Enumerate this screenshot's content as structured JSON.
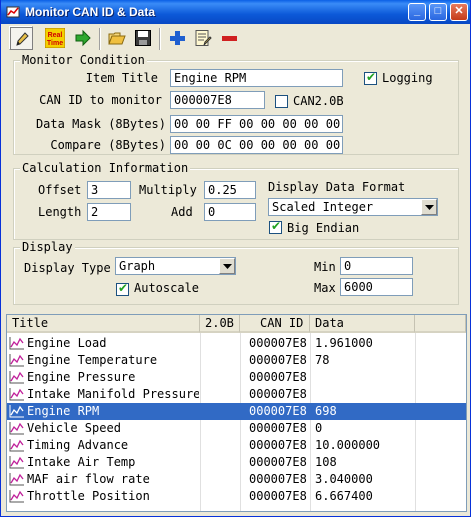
{
  "window": {
    "title": "Monitor CAN ID & Data"
  },
  "title_buttons": {
    "minimize": "_",
    "maximize": "□",
    "close": "✕"
  },
  "toolbar": {
    "items": [
      {
        "name": "edit-pencil-icon",
        "pressed": true
      },
      {
        "name": "realtime-icon",
        "text_top": "Real",
        "text_bottom": "Time"
      },
      {
        "name": "go-arrow-icon"
      },
      {
        "name": "open-folder-icon"
      },
      {
        "name": "save-disk-icon"
      },
      {
        "name": "add-plus-icon"
      },
      {
        "name": "edit-list-icon"
      },
      {
        "name": "remove-minus-icon"
      }
    ]
  },
  "monitor_condition": {
    "legend": "Monitor Condition",
    "item_title_label": "Item Title",
    "item_title_value": "Engine RPM",
    "logging_label": "Logging",
    "logging_checked": true,
    "can_id_label": "CAN ID to monitor",
    "can_id_value": "000007E8",
    "can20b_label": "CAN2.0B",
    "can20b_checked": false,
    "data_mask_label": "Data Mask (8Bytes)",
    "data_mask_value": "00 00 FF 00 00 00 00 00",
    "compare_label": "Compare (8Bytes)",
    "compare_value": "00 00 0C 00 00 00 00 00"
  },
  "calculation": {
    "legend": "Calculation Information",
    "offset_label": "Offset",
    "offset_value": "3",
    "multiply_label": "Multiply",
    "multiply_value": "0.25",
    "length_label": "Length",
    "length_value": "2",
    "add_label": "Add",
    "add_value": "0",
    "format_label": "Display Data Format",
    "format_value": "Scaled Integer",
    "big_endian_label": "Big Endian",
    "big_endian_checked": true
  },
  "display": {
    "legend": "Display",
    "type_label": "Display Type",
    "type_value": "Graph",
    "autoscale_label": "Autoscale",
    "autoscale_checked": true,
    "min_label": "Min",
    "min_value": "0",
    "max_label": "Max",
    "max_value": "6000"
  },
  "list": {
    "columns": [
      "Title",
      "2.0B",
      "CAN ID",
      "Data"
    ],
    "rows": [
      {
        "title": "Engine Load",
        "b20": "",
        "can_id": "000007E8",
        "data": "1.961000",
        "selected": false
      },
      {
        "title": "Engine Temperature",
        "b20": "",
        "can_id": "000007E8",
        "data": "78",
        "selected": false
      },
      {
        "title": "Engine Pressure",
        "b20": "",
        "can_id": "000007E8",
        "data": "",
        "selected": false
      },
      {
        "title": "Intake Manifold Pressure",
        "b20": "",
        "can_id": "000007E8",
        "data": "",
        "selected": false
      },
      {
        "title": "Engine RPM",
        "b20": "",
        "can_id": "000007E8",
        "data": "698",
        "selected": true
      },
      {
        "title": "Vehicle Speed",
        "b20": "",
        "can_id": "000007E8",
        "data": "0",
        "selected": false
      },
      {
        "title": "Timing Advance",
        "b20": "",
        "can_id": "000007E8",
        "data": "10.000000",
        "selected": false
      },
      {
        "title": "Intake Air Temp",
        "b20": "",
        "can_id": "000007E8",
        "data": "108",
        "selected": false
      },
      {
        "title": "MAF air flow rate",
        "b20": "",
        "can_id": "000007E8",
        "data": "3.040000",
        "selected": false
      },
      {
        "title": "Throttle Position",
        "b20": "",
        "can_id": "000007E8",
        "data": "6.667400",
        "selected": false
      }
    ]
  },
  "colors": {
    "selection": "#316ac5",
    "titlebar": "#0c59d8",
    "face": "#ece9d8"
  }
}
